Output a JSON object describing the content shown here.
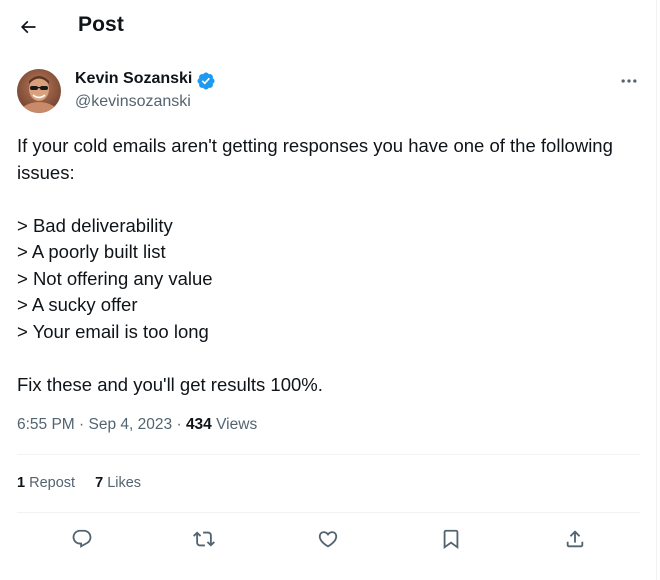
{
  "header": {
    "title": "Post"
  },
  "tweet": {
    "author": {
      "name": "Kevin Sozanski",
      "handle": "@kevinsozanski",
      "verified": true,
      "verified_color": "#1d9bf0"
    },
    "text_lines": [
      "If your cold emails aren't getting responses you have one of the following",
      "issues:",
      "",
      "> Bad deliverability",
      "> A poorly built list",
      "> Not offering any value",
      "> A sucky offer",
      "> Your email is too long",
      "",
      "Fix these and you'll get results 100%."
    ],
    "time": "6:55 PM",
    "date": "Sep 4, 2023",
    "separator": "·",
    "views_count": "434",
    "views_label": "Views"
  },
  "stats": {
    "reposts_count": "1",
    "reposts_label": "Repost",
    "likes_count": "7",
    "likes_label": "Likes"
  },
  "icons": {
    "back": "arrow-left-icon",
    "more": "more-horizontal-icon",
    "reply": "reply-bubble-icon",
    "repost": "repost-arrows-icon",
    "like": "heart-icon",
    "bookmark": "bookmark-icon",
    "share": "share-upload-icon"
  },
  "colors": {
    "text_primary": "#0f1419",
    "text_secondary": "#536471",
    "divider": "#eff3f4",
    "icon": "#536471"
  }
}
